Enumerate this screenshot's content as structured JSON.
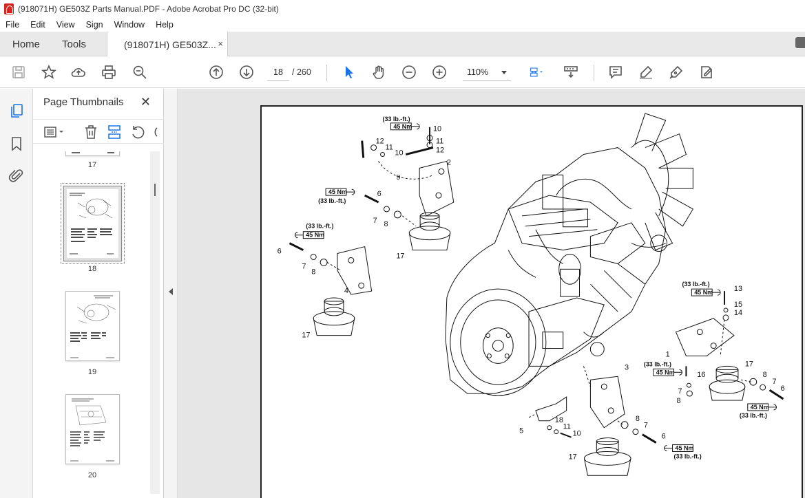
{
  "window": {
    "title": "(918071H) GE503Z Parts Manual.PDF - Adobe Acrobat Pro DC (32-bit)"
  },
  "menu": [
    "File",
    "Edit",
    "View",
    "Sign",
    "Window",
    "Help"
  ],
  "tabs": {
    "home": "Home",
    "tools": "Tools",
    "document": "(918071H) GE503Z...",
    "close_glyph": "×"
  },
  "toolbar": {
    "current_page": "18",
    "page_total": "/  260",
    "zoom": "110%"
  },
  "panel": {
    "title": "Page Thumbnails",
    "close_glyph": "✕",
    "thumbnails": [
      {
        "label": "17"
      },
      {
        "label": "18"
      },
      {
        "label": "19"
      },
      {
        "label": "20"
      }
    ]
  },
  "diagram": {
    "torque_labels": [
      "(33 lb.-ft.)",
      "45 Nm"
    ],
    "callouts": [
      "1",
      "2",
      "3",
      "4",
      "5",
      "6",
      "7",
      "8",
      "9",
      "10",
      "11",
      "12",
      "13",
      "14",
      "15",
      "16",
      "17",
      "18"
    ]
  },
  "colors": {
    "accent": "#1a73e8",
    "title_icon": "#d6261f",
    "tab_bar": "#e9e9e9"
  }
}
